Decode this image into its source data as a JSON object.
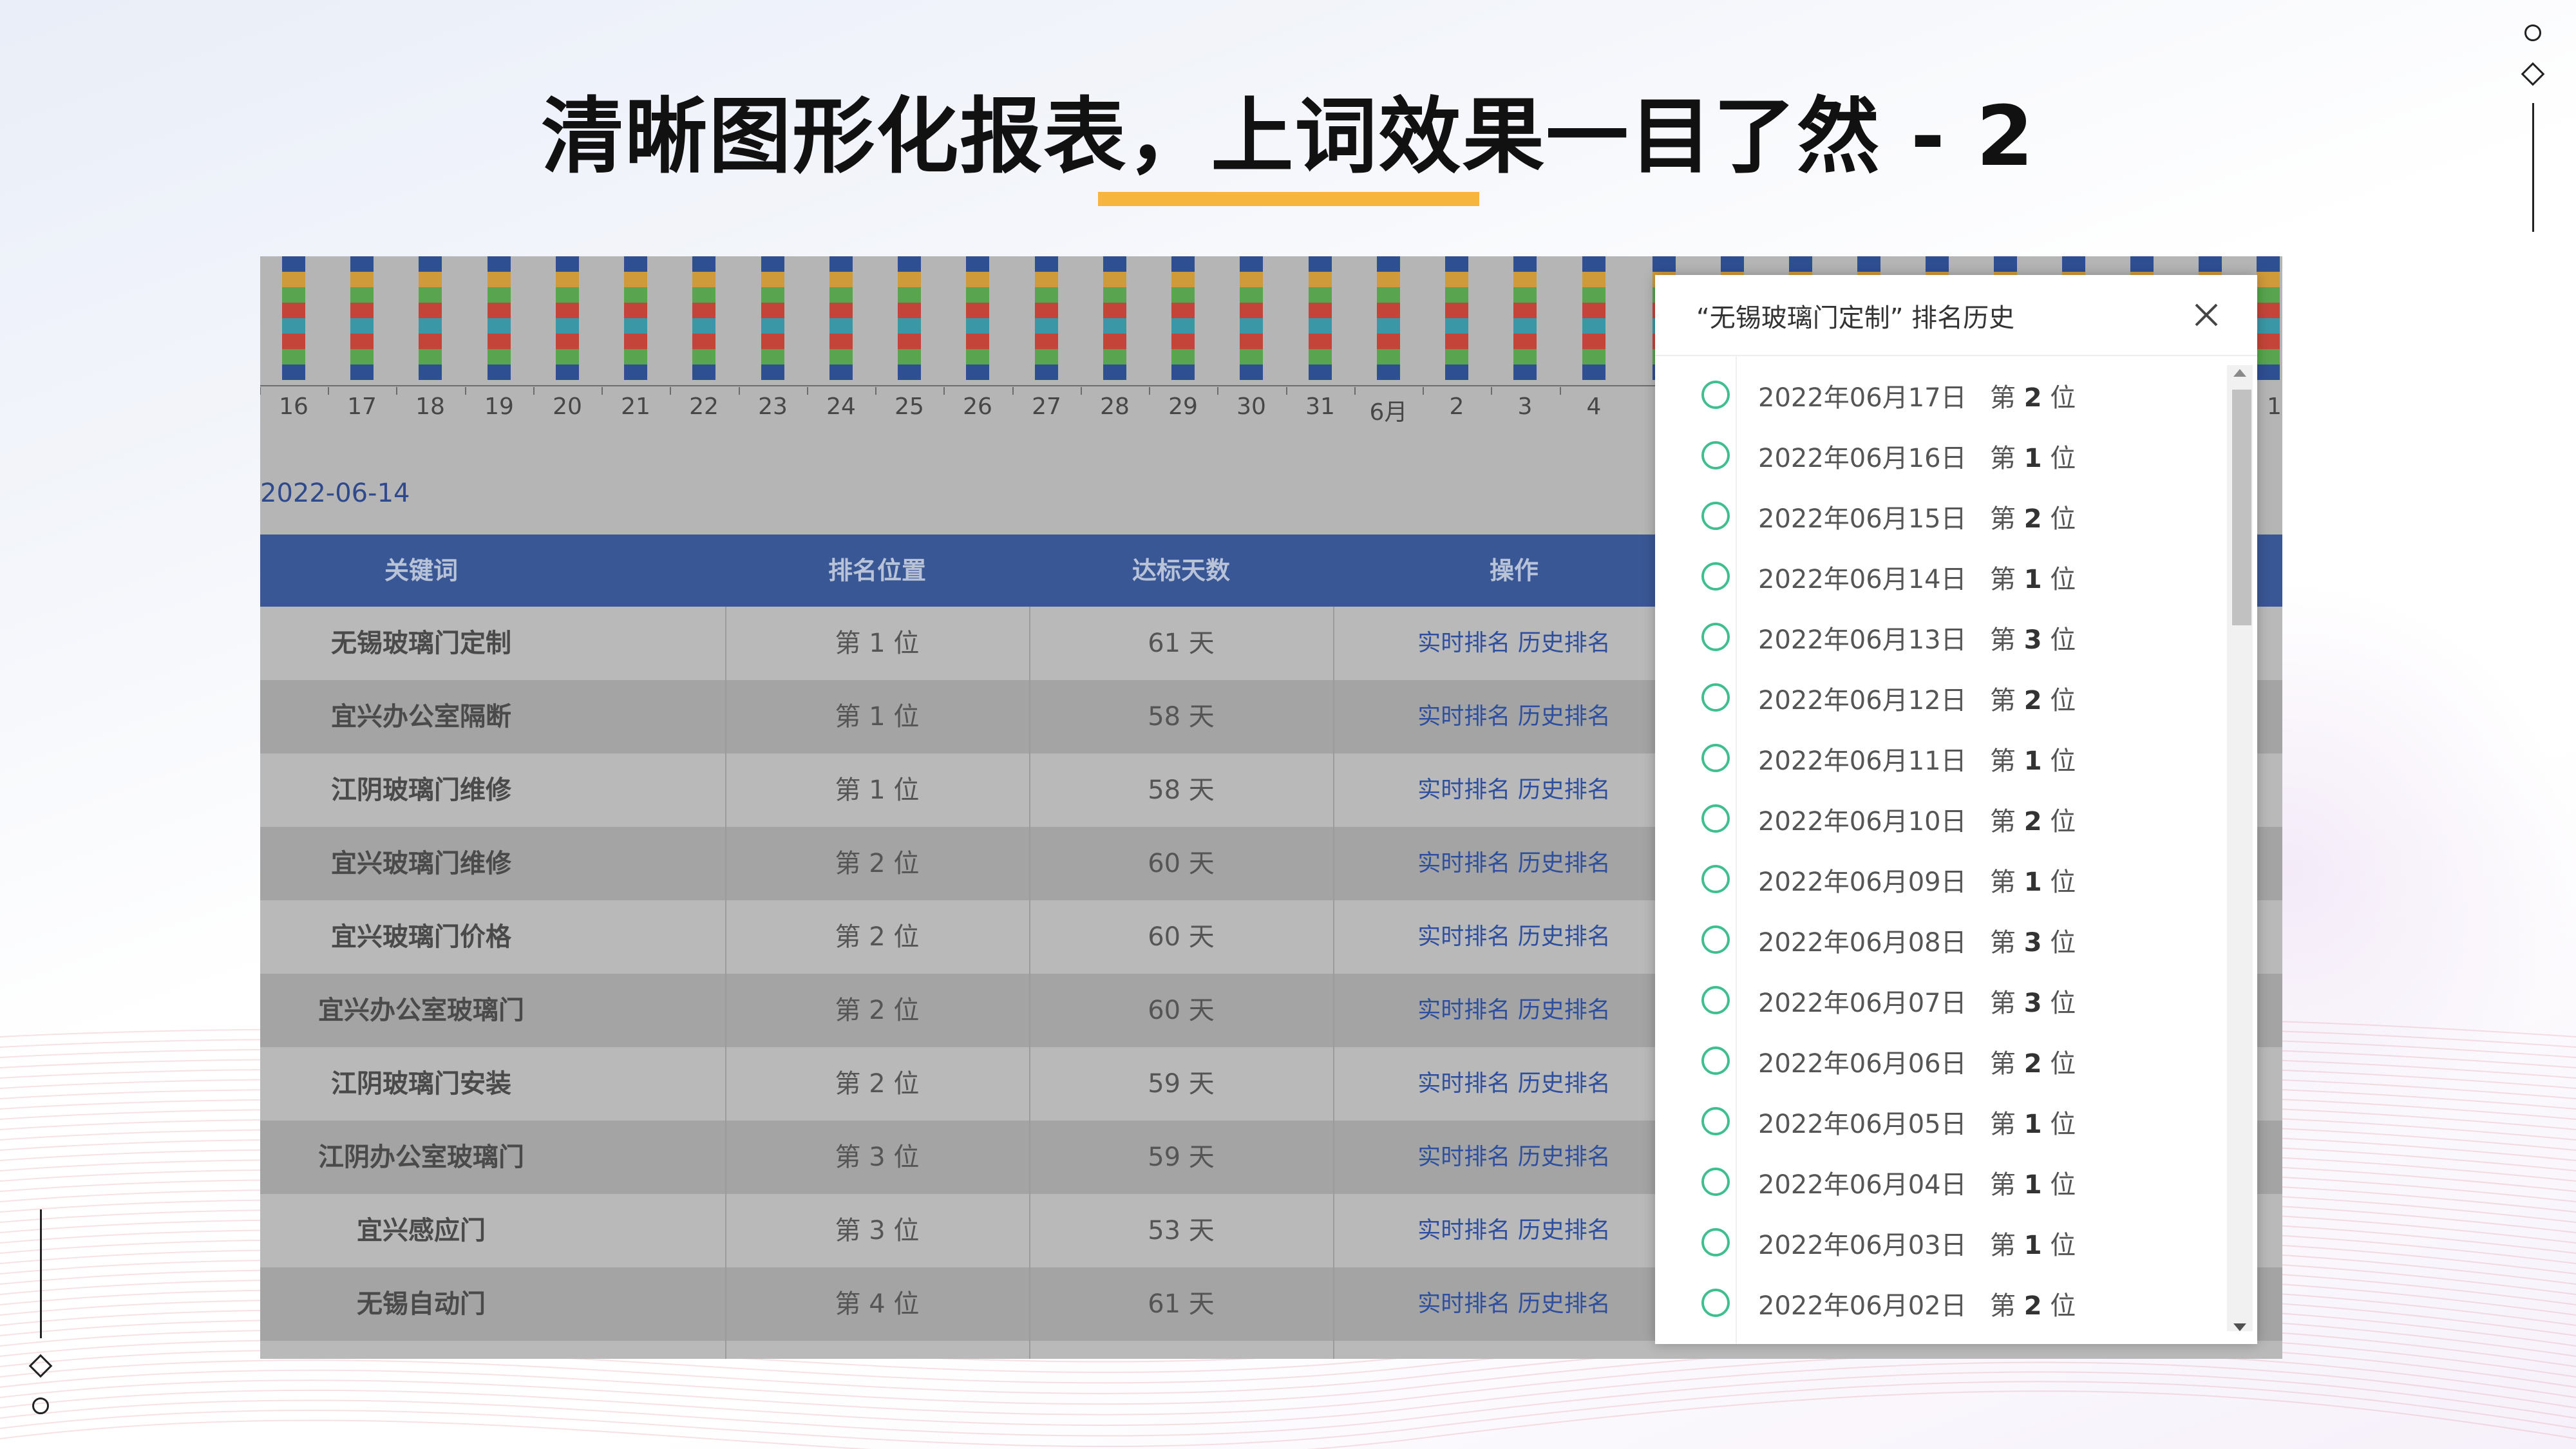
{
  "title": "清晰图形化报表，上词效果一目了然 - 2",
  "colors": {
    "accent": "#f6b63d",
    "header_bg": "#3a5795",
    "link": "#2e4f9e",
    "ok_circle": "#3fbf8f"
  },
  "chart": {
    "x_labels": [
      "16",
      "17",
      "18",
      "19",
      "20",
      "21",
      "22",
      "23",
      "24",
      "25",
      "26",
      "27",
      "28",
      "29",
      "30",
      "31",
      "6月",
      "2",
      "3",
      "4"
    ],
    "edge_label": "1"
  },
  "date_label": "2022-06-14",
  "table": {
    "headers": [
      "关键词",
      "排名位置",
      "达标天数",
      "操作"
    ],
    "rows": [
      {
        "keyword": "无锡玻璃门定制",
        "rank": "第 1 位",
        "days": "61 天",
        "action1": "实时排名",
        "action2": "历史排名"
      },
      {
        "keyword": "宜兴办公室隔断",
        "rank": "第 1 位",
        "days": "58 天",
        "action1": "实时排名",
        "action2": "历史排名"
      },
      {
        "keyword": "江阴玻璃门维修",
        "rank": "第 1 位",
        "days": "58 天",
        "action1": "实时排名",
        "action2": "历史排名"
      },
      {
        "keyword": "宜兴玻璃门维修",
        "rank": "第 2 位",
        "days": "60 天",
        "action1": "实时排名",
        "action2": "历史排名"
      },
      {
        "keyword": "宜兴玻璃门价格",
        "rank": "第 2 位",
        "days": "60 天",
        "action1": "实时排名",
        "action2": "历史排名"
      },
      {
        "keyword": "宜兴办公室玻璃门",
        "rank": "第 2 位",
        "days": "60 天",
        "action1": "实时排名",
        "action2": "历史排名"
      },
      {
        "keyword": "江阴玻璃门安装",
        "rank": "第 2 位",
        "days": "59 天",
        "action1": "实时排名",
        "action2": "历史排名"
      },
      {
        "keyword": "江阴办公室玻璃门",
        "rank": "第 3 位",
        "days": "59 天",
        "action1": "实时排名",
        "action2": "历史排名"
      },
      {
        "keyword": "宜兴感应门",
        "rank": "第 3 位",
        "days": "53 天",
        "action1": "实时排名",
        "action2": "历史排名"
      },
      {
        "keyword": "无锡自动门",
        "rank": "第 4 位",
        "days": "61 天",
        "action1": "实时排名",
        "action2": "历史排名"
      }
    ]
  },
  "dialog": {
    "title": "“无锡玻璃门定制” 排名历史",
    "close_icon": "close-icon",
    "rank_prefix": "第",
    "rank_suffix": "位",
    "items": [
      {
        "date": "2022年06月17日",
        "rank": "2"
      },
      {
        "date": "2022年06月16日",
        "rank": "1"
      },
      {
        "date": "2022年06月15日",
        "rank": "2"
      },
      {
        "date": "2022年06月14日",
        "rank": "1"
      },
      {
        "date": "2022年06月13日",
        "rank": "3"
      },
      {
        "date": "2022年06月12日",
        "rank": "2"
      },
      {
        "date": "2022年06月11日",
        "rank": "1"
      },
      {
        "date": "2022年06月10日",
        "rank": "2"
      },
      {
        "date": "2022年06月09日",
        "rank": "1"
      },
      {
        "date": "2022年06月08日",
        "rank": "3"
      },
      {
        "date": "2022年06月07日",
        "rank": "3"
      },
      {
        "date": "2022年06月06日",
        "rank": "2"
      },
      {
        "date": "2022年06月05日",
        "rank": "1"
      },
      {
        "date": "2022年06月04日",
        "rank": "1"
      },
      {
        "date": "2022年06月03日",
        "rank": "1"
      },
      {
        "date": "2022年06月02日",
        "rank": "2"
      }
    ]
  }
}
